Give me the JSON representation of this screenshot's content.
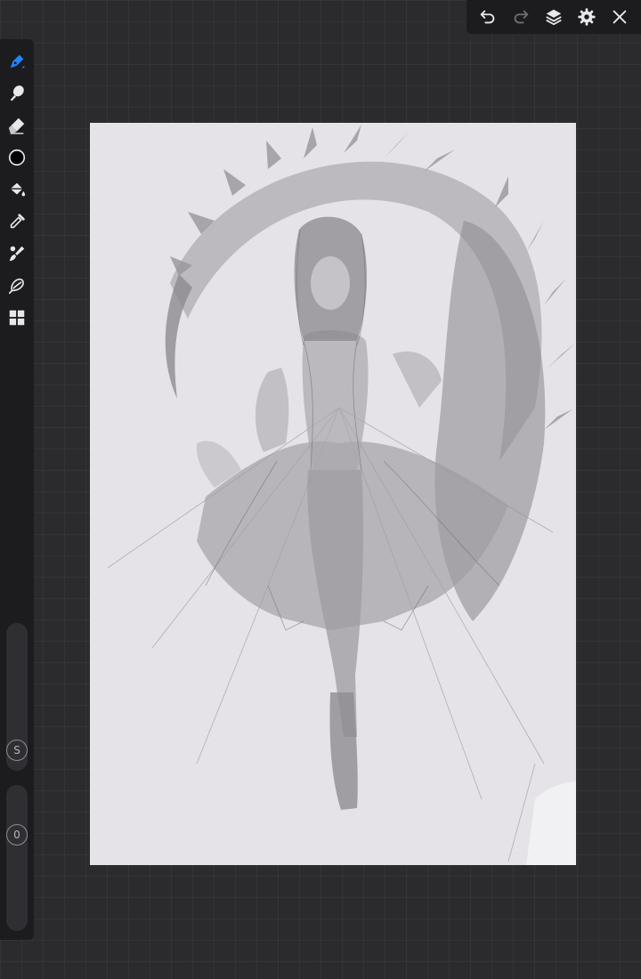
{
  "topbar": {
    "buttons": [
      {
        "name": "undo-icon"
      },
      {
        "name": "redo-icon"
      },
      {
        "name": "layers-icon"
      },
      {
        "name": "gear-icon"
      },
      {
        "name": "close-icon"
      }
    ]
  },
  "toolbar": {
    "tools": [
      {
        "name": "pen-icon",
        "active": true
      },
      {
        "name": "brush-icon"
      },
      {
        "name": "eraser-icon"
      },
      {
        "name": "color-circle-icon"
      },
      {
        "name": "paint-bucket-icon"
      },
      {
        "name": "eyedropper-icon"
      },
      {
        "name": "blend-brush-icon"
      },
      {
        "name": "lasso-icon"
      },
      {
        "name": "grid-icon"
      }
    ],
    "size_slider": {
      "label": "S"
    },
    "opacity_slider": {
      "label": "0"
    }
  },
  "colors": {
    "accent": "#1e86ff",
    "icon": "#e8e8ea",
    "icon_disabled": "#6e6e73",
    "panel": "#1c1c1f",
    "workspace": "#2b2b2e",
    "canvas": "#e5e3e7"
  }
}
